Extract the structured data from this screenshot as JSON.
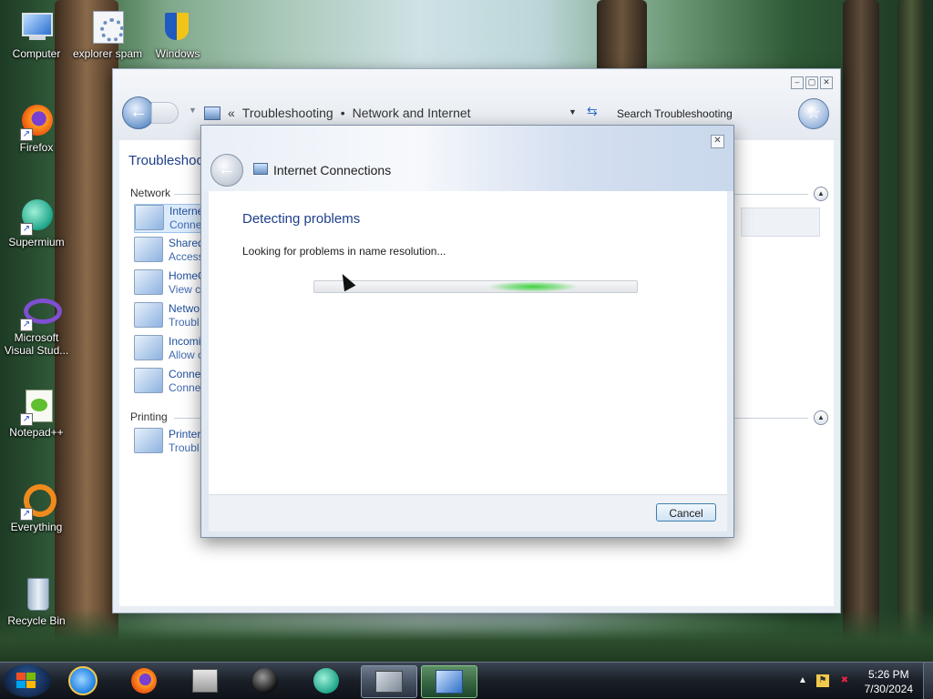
{
  "desktop": {
    "icons": [
      {
        "label": "Computer"
      },
      {
        "label": "explorer spam"
      },
      {
        "label": "Windows"
      },
      {
        "label": "Firefox"
      },
      {
        "label": "Supermium"
      },
      {
        "label": "Microsoft Visual Stud..."
      },
      {
        "label": "Notepad++"
      },
      {
        "label": "Everything"
      },
      {
        "label": "Recycle Bin"
      }
    ]
  },
  "control_panel": {
    "breadcrumb": {
      "sep": "«",
      "part1": "Troubleshooting",
      "dot": "•",
      "part2": "Network and Internet"
    },
    "search_placeholder": "Search Troubleshooting",
    "page_title": "Troubleshoo",
    "sections": [
      {
        "name": "Network"
      },
      {
        "name": "Printing"
      }
    ],
    "items": [
      {
        "line1": "Interne",
        "line2": "Conne"
      },
      {
        "line1": "Shared",
        "line2": "Access"
      },
      {
        "line1": "HomeG",
        "line2": "View co"
      },
      {
        "line1": "Netwo",
        "line2": "Troubl"
      },
      {
        "line1": "Incomi",
        "line2": "Allow c"
      },
      {
        "line1": "Conne",
        "line2": "Conne"
      },
      {
        "line1": "Printer",
        "line2": "Troubl"
      }
    ]
  },
  "dialog": {
    "title": "Internet Connections",
    "heading": "Detecting problems",
    "status": "Looking for problems in name resolution...",
    "cancel_label": "Cancel",
    "close_glyph": "✕"
  },
  "taskbar": {
    "clock_time": "5:26 PM",
    "clock_date": "7/30/2024",
    "apps": [
      "start-button",
      "internet-explorer",
      "firefox",
      "file-explorer",
      "media-app",
      "supermium",
      "control-panel",
      "troubleshooter"
    ]
  },
  "colors": {
    "accent": "#1e3f8a",
    "progress": "#3fd23f"
  }
}
